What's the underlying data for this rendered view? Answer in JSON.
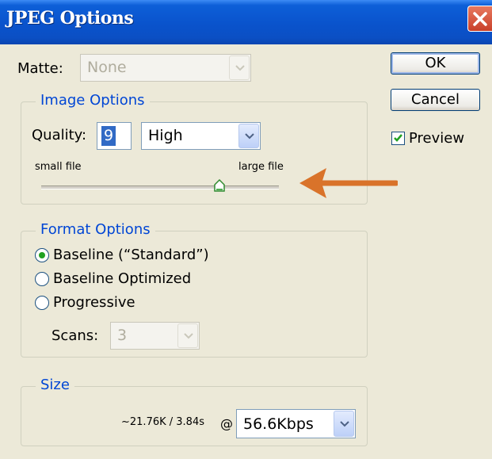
{
  "window": {
    "title": "JPEG Options"
  },
  "matte": {
    "label": "Matte:",
    "value": "None"
  },
  "buttons": {
    "ok": "OK",
    "cancel": "Cancel"
  },
  "preview": {
    "label": "Preview",
    "checked": true
  },
  "image_options": {
    "legend": "Image Options",
    "quality_label": "Quality:",
    "quality_value": "9",
    "quality_preset": "High",
    "slider_left_label": "small file",
    "slider_right_label": "large file",
    "slider_level": 0.75
  },
  "format_options": {
    "legend": "Format Options",
    "options": [
      "Baseline (“Standard”)",
      "Baseline Optimized",
      "Progressive"
    ],
    "selected_index": 0,
    "scans_label": "Scans:",
    "scans_value": "3"
  },
  "size": {
    "legend": "Size",
    "estimate": "~21.76K / 3.84s",
    "at": "@",
    "speed": "56.6Kbps"
  },
  "colors": {
    "annotation_arrow": "#d9732a",
    "titlebar": "#0a53cc",
    "legend_text": "#0046d5"
  }
}
